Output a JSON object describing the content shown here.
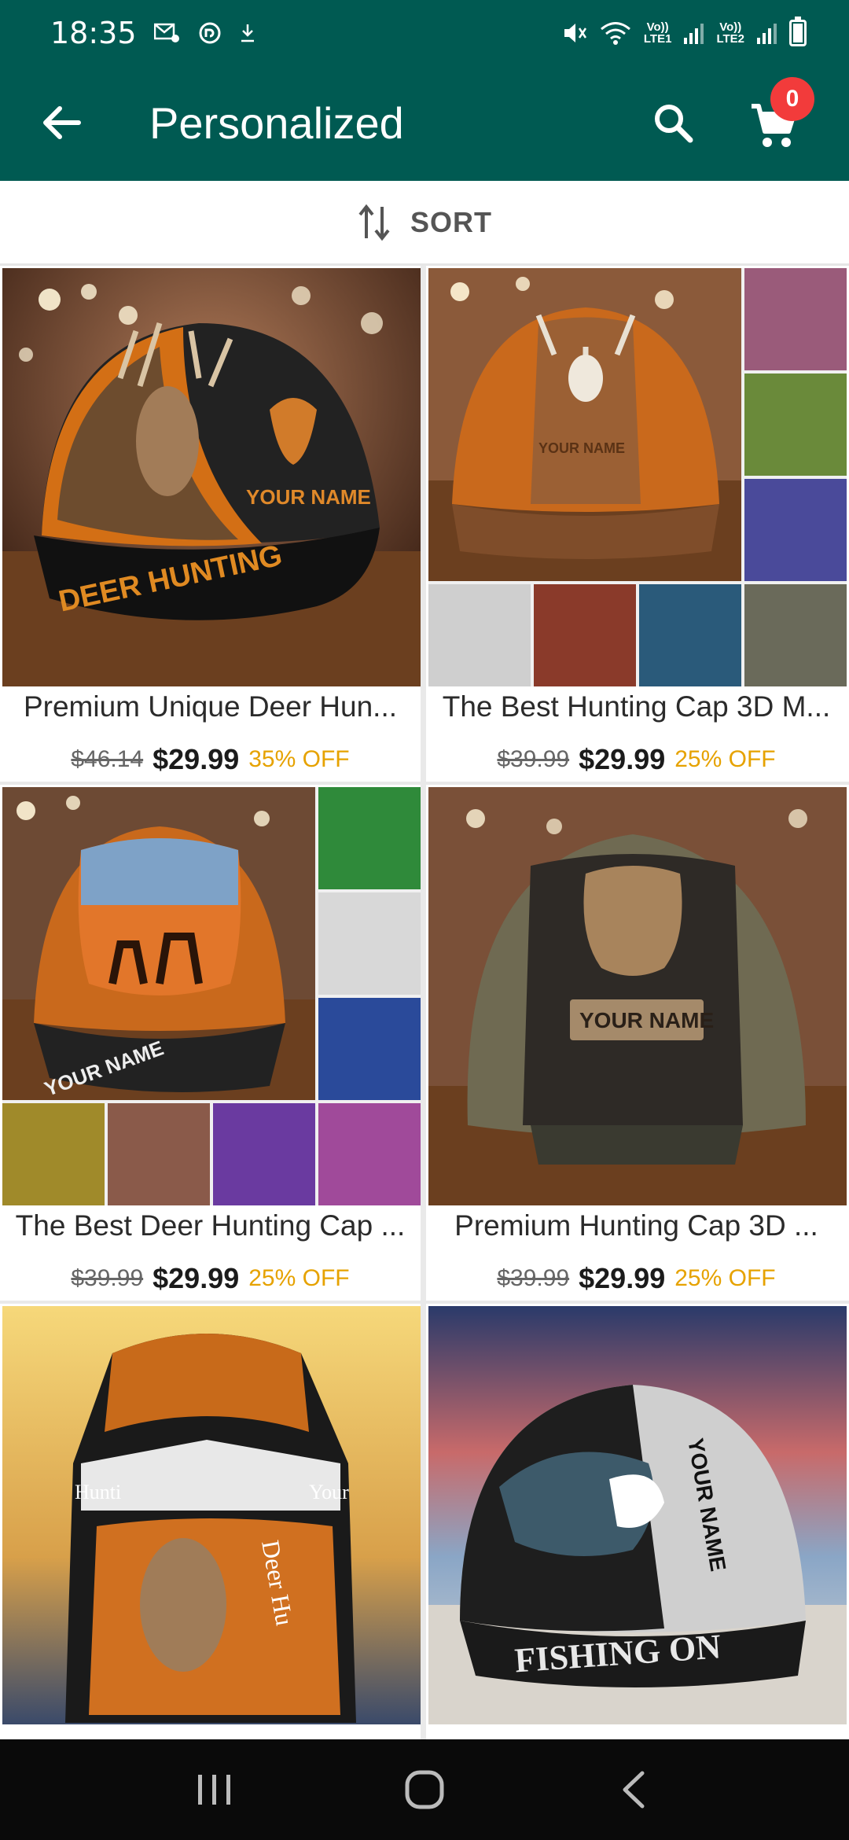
{
  "status_bar": {
    "time": "18:35",
    "net1": "Vo))\nLTE1",
    "net1_top": "Vo))",
    "net1_bottom": "LTE1",
    "net2_top": "Vo))",
    "net2_bottom": "LTE2"
  },
  "app_bar": {
    "title": "Personalized",
    "cart_count": "0"
  },
  "sort": {
    "label": "SORT"
  },
  "products": [
    {
      "title": "Premium Unique Deer Hun...",
      "old_price": "$46.14",
      "price": "$29.99",
      "discount": "35% OFF",
      "image_text": [
        "YOUR NAME",
        "DEER HUNTING"
      ]
    },
    {
      "title": "The Best Hunting Cap 3D M...",
      "old_price": "$39.99",
      "price": "$29.99",
      "discount": "25% OFF",
      "image_text": [
        "YOUR NAME"
      ]
    },
    {
      "title": "The Best Deer Hunting Cap ...",
      "old_price": "$39.99",
      "price": "$29.99",
      "discount": "25% OFF",
      "image_text": [
        "YOUR NAME"
      ]
    },
    {
      "title": "Premium Hunting Cap 3D ...",
      "old_price": "$39.99",
      "price": "$29.99",
      "discount": "25% OFF",
      "image_text": [
        "YOUR NAME"
      ]
    },
    {
      "title": "",
      "image_text": [
        "Hunti",
        "Your",
        "Deer Hu"
      ]
    },
    {
      "title": "",
      "image_text": [
        "YOUR NAME",
        "FISHING ON"
      ]
    }
  ],
  "colors": {
    "primary": "#005a52",
    "badge": "#f23b3b",
    "discount": "#e6a200",
    "nav": "#0a0a0a"
  },
  "icons": {
    "back": "arrow-left-icon",
    "search": "search-icon",
    "cart": "cart-icon",
    "sort": "sort-arrows-icon",
    "nav_recent": "recent-apps-icon",
    "nav_home": "home-icon",
    "nav_back": "back-chevron-icon"
  }
}
